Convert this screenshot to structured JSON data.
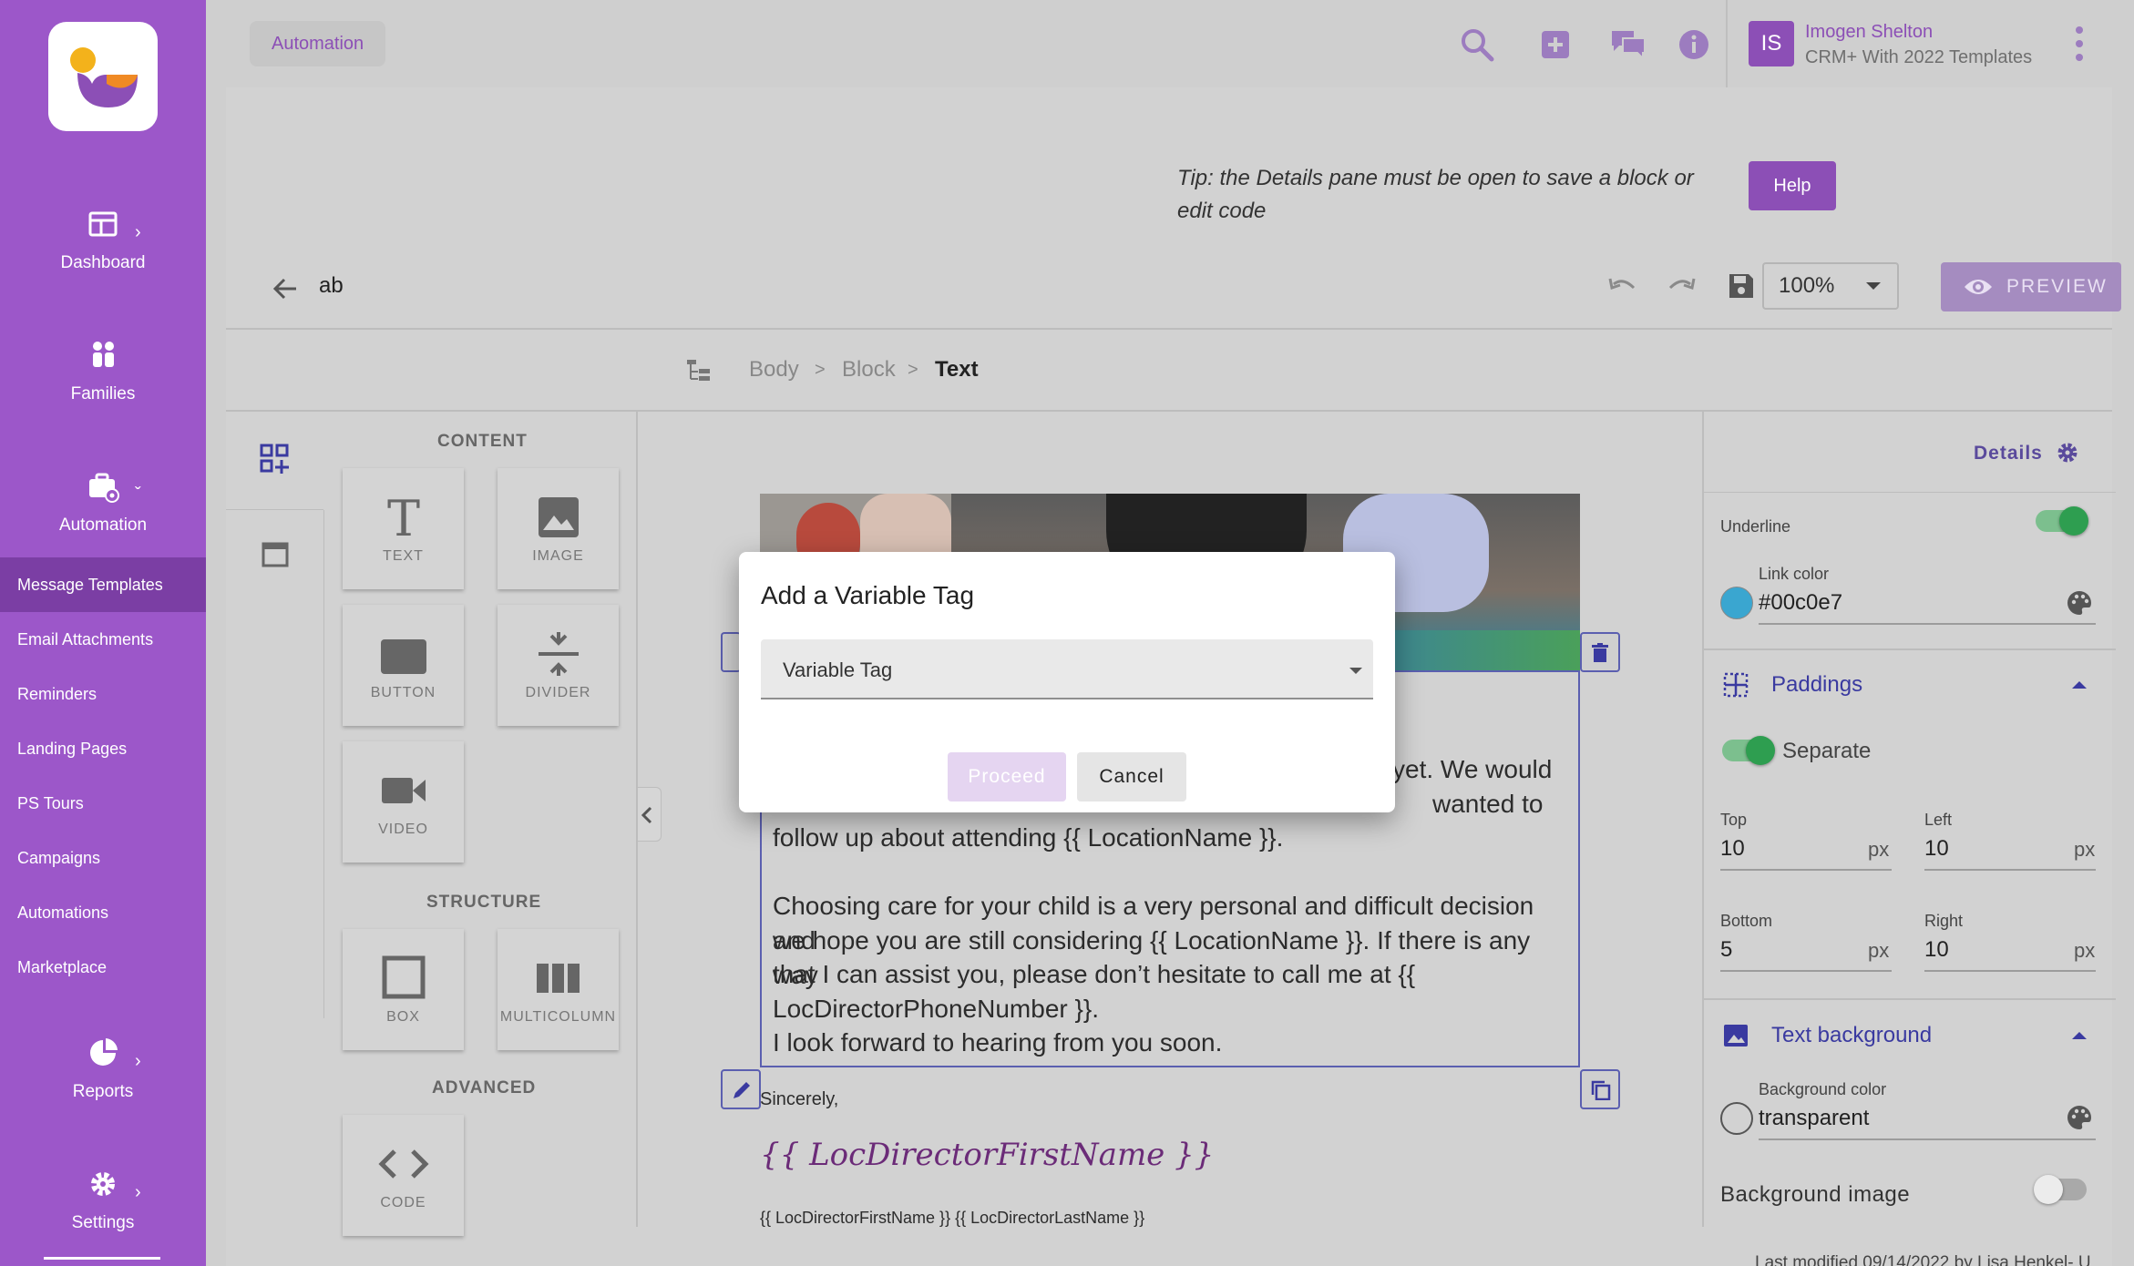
{
  "sidebar": {
    "nav": [
      {
        "label": "Dashboard",
        "icon": "dashboard-icon"
      },
      {
        "label": "Families",
        "icon": "families-icon"
      },
      {
        "label": "Automation",
        "icon": "automation-icon"
      },
      {
        "label": "Reports",
        "icon": "reports-icon"
      },
      {
        "label": "Settings",
        "icon": "settings-icon"
      }
    ],
    "subitems": [
      "Message Templates",
      "Email Attachments",
      "Reminders",
      "Landing Pages",
      "PS Tours",
      "Campaigns",
      "Automations",
      "Marketplace"
    ],
    "active_subitem": "Message Templates"
  },
  "header": {
    "breadcrumb": "Automation",
    "user": {
      "initials": "IS",
      "name": "Imogen Shelton",
      "org": "CRM+ With 2022 Templates"
    }
  },
  "tip": {
    "text": "Tip: the Details pane must be open to save a block or edit code",
    "help_label": "Help"
  },
  "editor": {
    "document_name": "ab",
    "zoom": "100%",
    "preview_label": "PREVIEW",
    "breadcrumb": [
      "Body",
      "Block",
      "Text"
    ],
    "separator": ">"
  },
  "blocks": {
    "content_title": "CONTENT",
    "structure_title": "STRUCTURE",
    "advanced_title": "ADVANCED",
    "content": [
      "TEXT",
      "IMAGE",
      "BUTTON",
      "DIVIDER",
      "VIDEO"
    ],
    "structure": [
      "BOX",
      "MULTICOLUMN"
    ],
    "advanced": [
      "CODE"
    ]
  },
  "canvas": {
    "line1_partial": "yet. We would",
    "line2_partial": "wanted to",
    "line3": "follow up about attending {{ LocationName }}.",
    "para2": [
      "Choosing care for your child is a very personal and difficult decision and",
      "we hope you are still considering {{ LocationName }}. If there is any way",
      "that I can assist you, please don’t hesitate to call me at {{",
      "LocDirectorPhoneNumber }}.",
      "I look forward to hearing from you soon."
    ],
    "sincerely": "Sincerely,",
    "signature": "{{ LocDirectorFirstName }}",
    "signature_name": "{{ LocDirectorFirstName }} {{ LocDirectorLastName }}"
  },
  "details": {
    "title": "Details",
    "underline_label": "Underline",
    "underline_on": true,
    "link_color_label": "Link color",
    "link_color": "#00c0e7",
    "paddings_title": "Paddings",
    "separate_label": "Separate",
    "separate_on": true,
    "top_label": "Top",
    "top": "10",
    "left_label": "Left",
    "left": "10",
    "bottom_label": "Bottom",
    "bottom": "5",
    "right_label": "Right",
    "right": "10",
    "unit": "px",
    "text_background_title": "Text background",
    "bg_color_label": "Background color",
    "bg_color": "transparent",
    "bg_image_label": "Background image",
    "bg_image_on": false
  },
  "footer": {
    "text": "Last modified 09/14/2022 by Lisa Henkel- U"
  },
  "modal": {
    "title": "Add a Variable Tag",
    "select_value": "Variable Tag",
    "proceed_label": "Proceed",
    "cancel_label": "Cancel"
  },
  "colors": {
    "sidebar": "#9c57c9",
    "sidebar_active": "#7b3ea4",
    "accent": "#8c4fb6",
    "toggle_on": "#2e9e50",
    "selection": "#5b5fb0"
  }
}
